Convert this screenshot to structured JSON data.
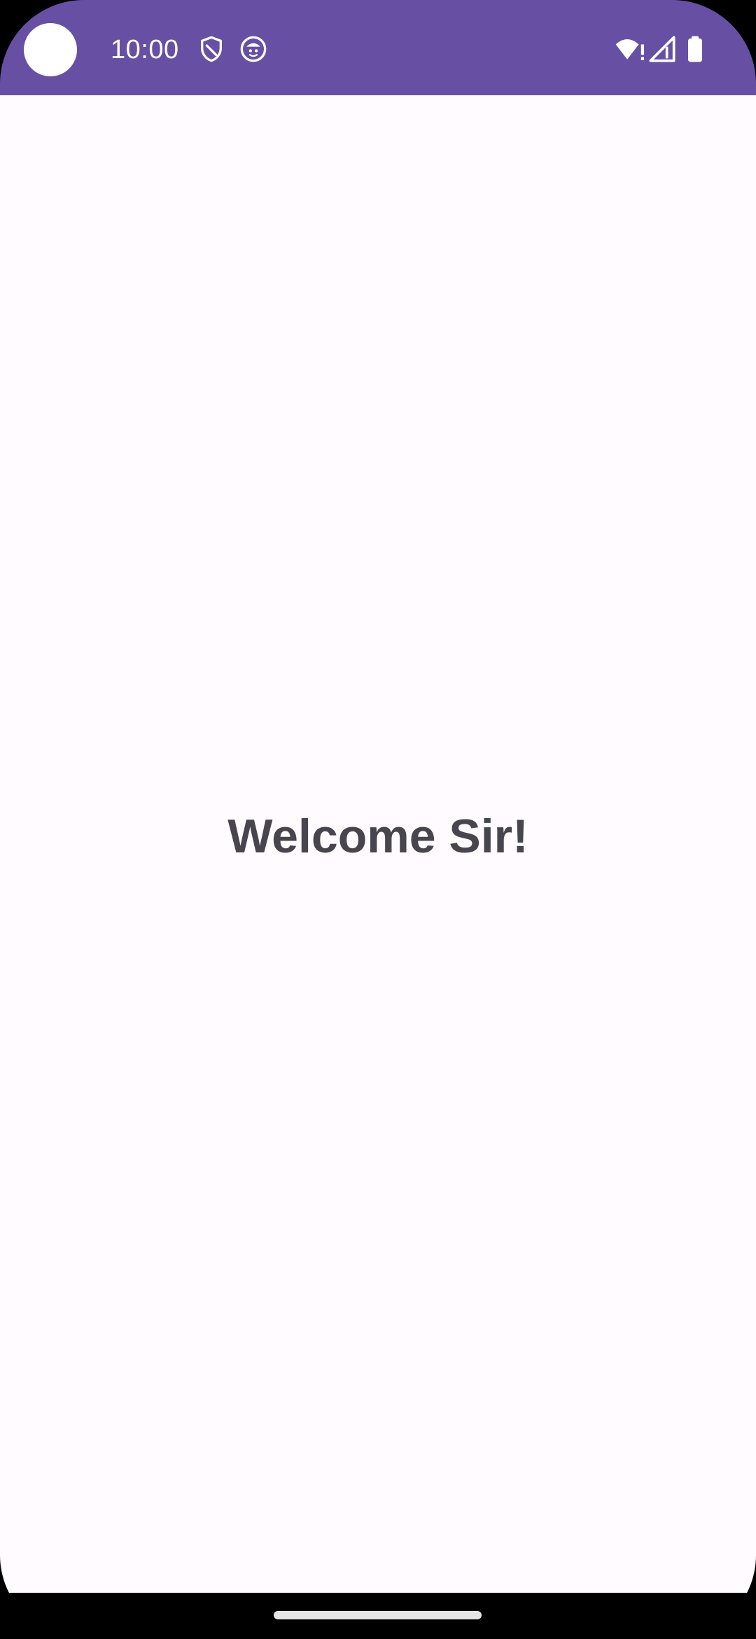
{
  "status_bar": {
    "time": "10:00",
    "background": "#6750A4",
    "icons_left": [
      "shield-icon",
      "app-notification-icon"
    ],
    "icons_right": [
      "wifi-alert-icon",
      "cellular-signal-icon",
      "battery-icon"
    ]
  },
  "main": {
    "welcome_text": "Welcome Sir!",
    "background": "#FFFBFE",
    "text_color": "#49454F"
  },
  "nav_bar": {
    "type": "gesture-handle"
  }
}
